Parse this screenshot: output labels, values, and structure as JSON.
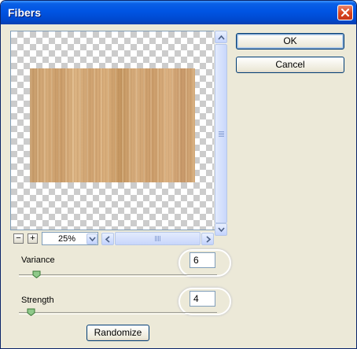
{
  "window": {
    "title": "Fibers"
  },
  "buttons": {
    "ok_label": "OK",
    "cancel_label": "Cancel",
    "randomize_label": "Randomize"
  },
  "zoom": {
    "value": "25%",
    "minus_label": "−",
    "plus_label": "+"
  },
  "controls": {
    "variance": {
      "label": "Variance",
      "value": "6",
      "slider_fraction": 0.09
    },
    "strength": {
      "label": "Strength",
      "value": "4",
      "slider_fraction": 0.06
    }
  },
  "colors": {
    "title_bar": "#0054e3",
    "close_button": "#d8431c",
    "dialog_bg": "#ece9d8",
    "wood": "#d2a673"
  },
  "icons": {
    "close": "close-icon",
    "scroll_up": "arrow-up-icon",
    "scroll_down": "arrow-down-icon",
    "scroll_left": "arrow-left-icon",
    "scroll_right": "arrow-right-icon",
    "dropdown": "chevron-down-icon"
  }
}
